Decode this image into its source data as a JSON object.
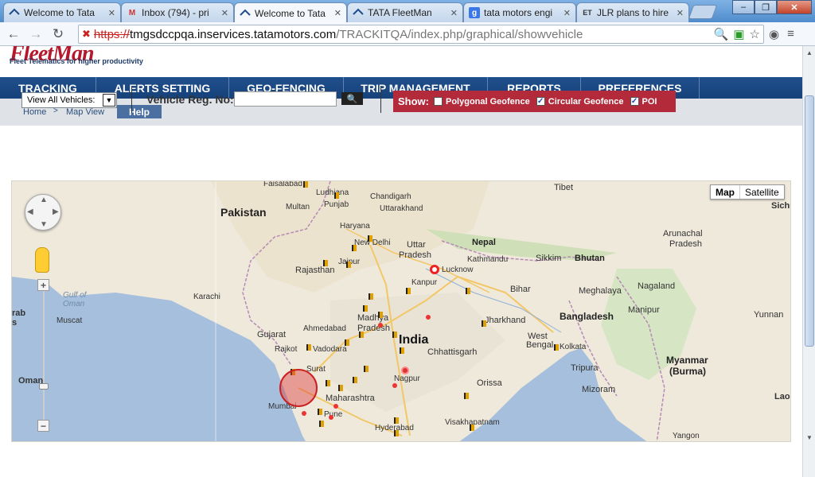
{
  "browser": {
    "tabs": [
      {
        "title": "Welcome to Tata",
        "icon": "tata-icon",
        "active": false
      },
      {
        "title": "Inbox (794) - pri",
        "icon": "gmail-icon",
        "active": false
      },
      {
        "title": "Welcome to Tata",
        "icon": "tata-icon",
        "active": true
      },
      {
        "title": "TATA FleetMan",
        "icon": "tata-icon",
        "active": false
      },
      {
        "title": "tata motors engi",
        "icon": "google-icon",
        "active": false
      },
      {
        "title": "JLR plans to hire",
        "icon": "et-icon",
        "active": false
      }
    ],
    "url_https": "https://",
    "url_host": "tmgsdccpqa.inservices.tatamotors.com",
    "url_path": "/TRACKITQA/index.php/graphical/showvehicle",
    "et_glyph": "ET"
  },
  "brand": {
    "name": "FleetMan",
    "tagline": "Fleet Telematics for higher productivity"
  },
  "mainnav": [
    {
      "label": "TRACKING"
    },
    {
      "label": "ALERTS SETTING"
    },
    {
      "label": "GEO-FENCING"
    },
    {
      "label": "TRIP MANAGEMENT"
    },
    {
      "label": "REPORTS"
    },
    {
      "label": "PREFERENCES"
    }
  ],
  "breadcrumb": {
    "home": "Home",
    "sep": ">",
    "current": "Map View",
    "help": "Help"
  },
  "filters": {
    "vehicle_select": "View All Vehicles:",
    "reg_label": "Vehicle Reg. No:",
    "reg_value": "",
    "show_label": "Show:",
    "options": [
      {
        "label": "Polygonal Geofence",
        "checked": false
      },
      {
        "label": "Circular Geofence",
        "checked": true
      },
      {
        "label": "POI",
        "checked": true
      }
    ]
  },
  "map": {
    "type_buttons": [
      "Map",
      "Satellite"
    ],
    "selected_type": "Map",
    "labels": {
      "pakistan": "Pakistan",
      "india": "India",
      "nepal": "Nepal",
      "bhutan": "Bhutan",
      "bangladesh": "Bangladesh",
      "myanmar": "Myanmar",
      "burma": "(Burma)",
      "tibet": "Tibet",
      "faisalabad": "Faisalabad",
      "ludhiana": "Ludhiana",
      "chandigarh": "Chandigarh",
      "multan": "Multan",
      "punjab": "Punjab",
      "uttarakhand": "Uttarakhand",
      "haryana": "Haryana",
      "new_delhi": "New Delhi",
      "uttar": "Uttar",
      "pradesh": "Pradesh",
      "kathmandu": "Kathmandu",
      "sikkim": "Sikkim",
      "arunachal": "Arunachal",
      "arunachal_pradesh": "Pradesh",
      "rajasthan": "Rajasthan",
      "jaipur": "Jaipur",
      "lucknow": "Lucknow",
      "kanpur": "Kanpur",
      "bihar": "Bihar",
      "meghalaya": "Meghalaya",
      "nagaland": "Nagaland",
      "karachi": "Karachi",
      "gulf_of_oman": "Gulf of\nOman",
      "muscat": "Muscat",
      "oman": "Oman",
      "arabia": "rab\ns",
      "ahmedabad": "Ahmedabad",
      "gujarat": "Gujarat",
      "madhya": "Madhya",
      "madhya_pradesh": "Pradesh",
      "jharkhand": "Jharkhand",
      "west": "West",
      "bengal": "Bengal",
      "manipur": "Manipur",
      "yunnan": "Yunnan",
      "rajkot": "Rajkot",
      "vadodara": "Vadodara",
      "chhattisgarh": "Chhattisgarh",
      "tripura": "Tripura",
      "mizoram": "Mizoram",
      "surat": "Surat",
      "nagpur": "Nagpur",
      "maharashtra": "Maharashtra",
      "orissa": "Orissa",
      "mumbai": "Mumbai",
      "pune": "Pune",
      "hyderabad": "Hyderabad",
      "visakhapatnam": "Visakhapatnam",
      "yangon": "Yangon",
      "lao": "Lao",
      "sichuan": "Sichu",
      "kolkata": "Kolkata"
    },
    "zoom_plus": "+",
    "zoom_minus": "−"
  },
  "colors": {
    "nav_bg": "#1f4f8c",
    "brand_red": "#b5182c",
    "show_bg": "#b32b3a",
    "water": "#a5bfdd",
    "land": "#efe9dc"
  }
}
